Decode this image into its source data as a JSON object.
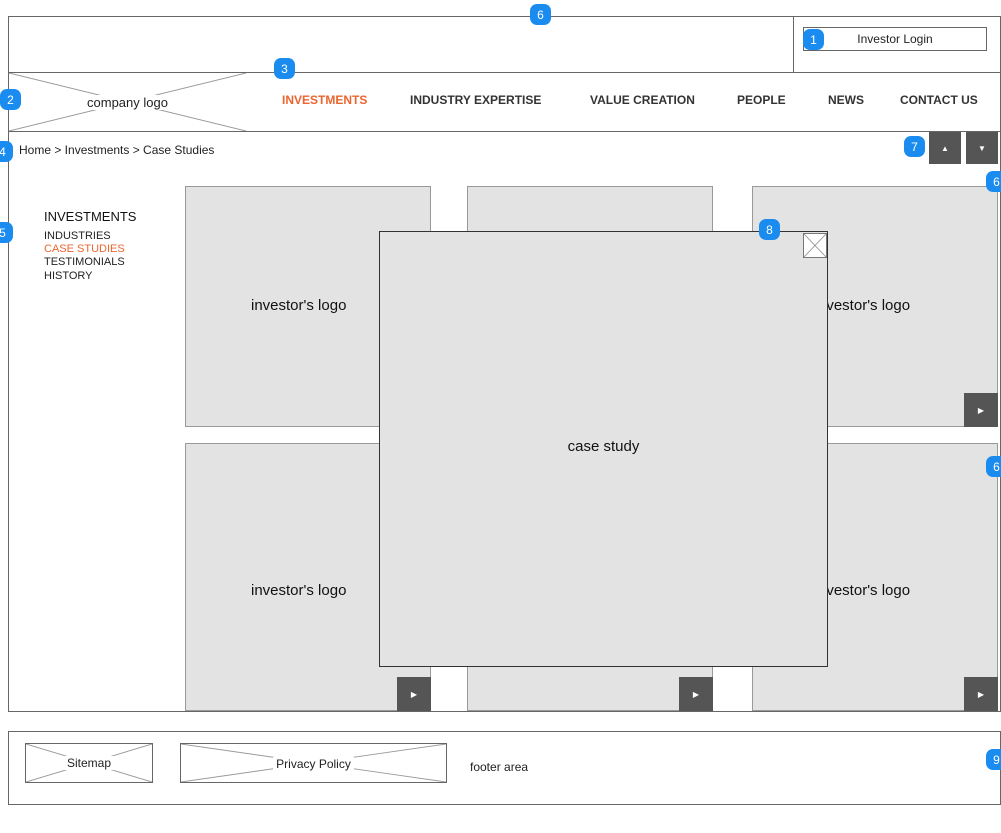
{
  "header": {
    "login_label": "Investor Login",
    "logo_label": "company logo"
  },
  "nav": {
    "items": [
      {
        "label": "INVESTMENTS",
        "active": true
      },
      {
        "label": "INDUSTRY EXPERTISE"
      },
      {
        "label": "VALUE CREATION"
      },
      {
        "label": "PEOPLE"
      },
      {
        "label": "NEWS"
      },
      {
        "label": "CONTACT US"
      }
    ]
  },
  "breadcrumb": "Home > Investments > Case Studies",
  "sidebar": {
    "heading": "INVESTMENTS",
    "items": [
      {
        "label": "INDUSTRIES"
      },
      {
        "label": "CASE STUDIES",
        "active": true
      },
      {
        "label": "TESTIMONIALS"
      },
      {
        "label": "HISTORY"
      }
    ]
  },
  "cards": {
    "label": "investor's logo",
    "label_partial": "nvestor's logo"
  },
  "overlay": {
    "label": "case study"
  },
  "footer": {
    "sitemap_label": "Sitemap",
    "privacy_label": "Privacy Policy",
    "area_label": "footer area"
  },
  "badges": [
    "1",
    "2",
    "3",
    "4",
    "5",
    "6",
    "7",
    "8",
    "9"
  ],
  "colors": {
    "accent": "#ec6530",
    "badge": "#1a8cf0",
    "card_bg": "#e3e3e3",
    "button_bg": "#555555"
  },
  "icons": {
    "up": "▲",
    "down": "▼",
    "play": "▶"
  }
}
